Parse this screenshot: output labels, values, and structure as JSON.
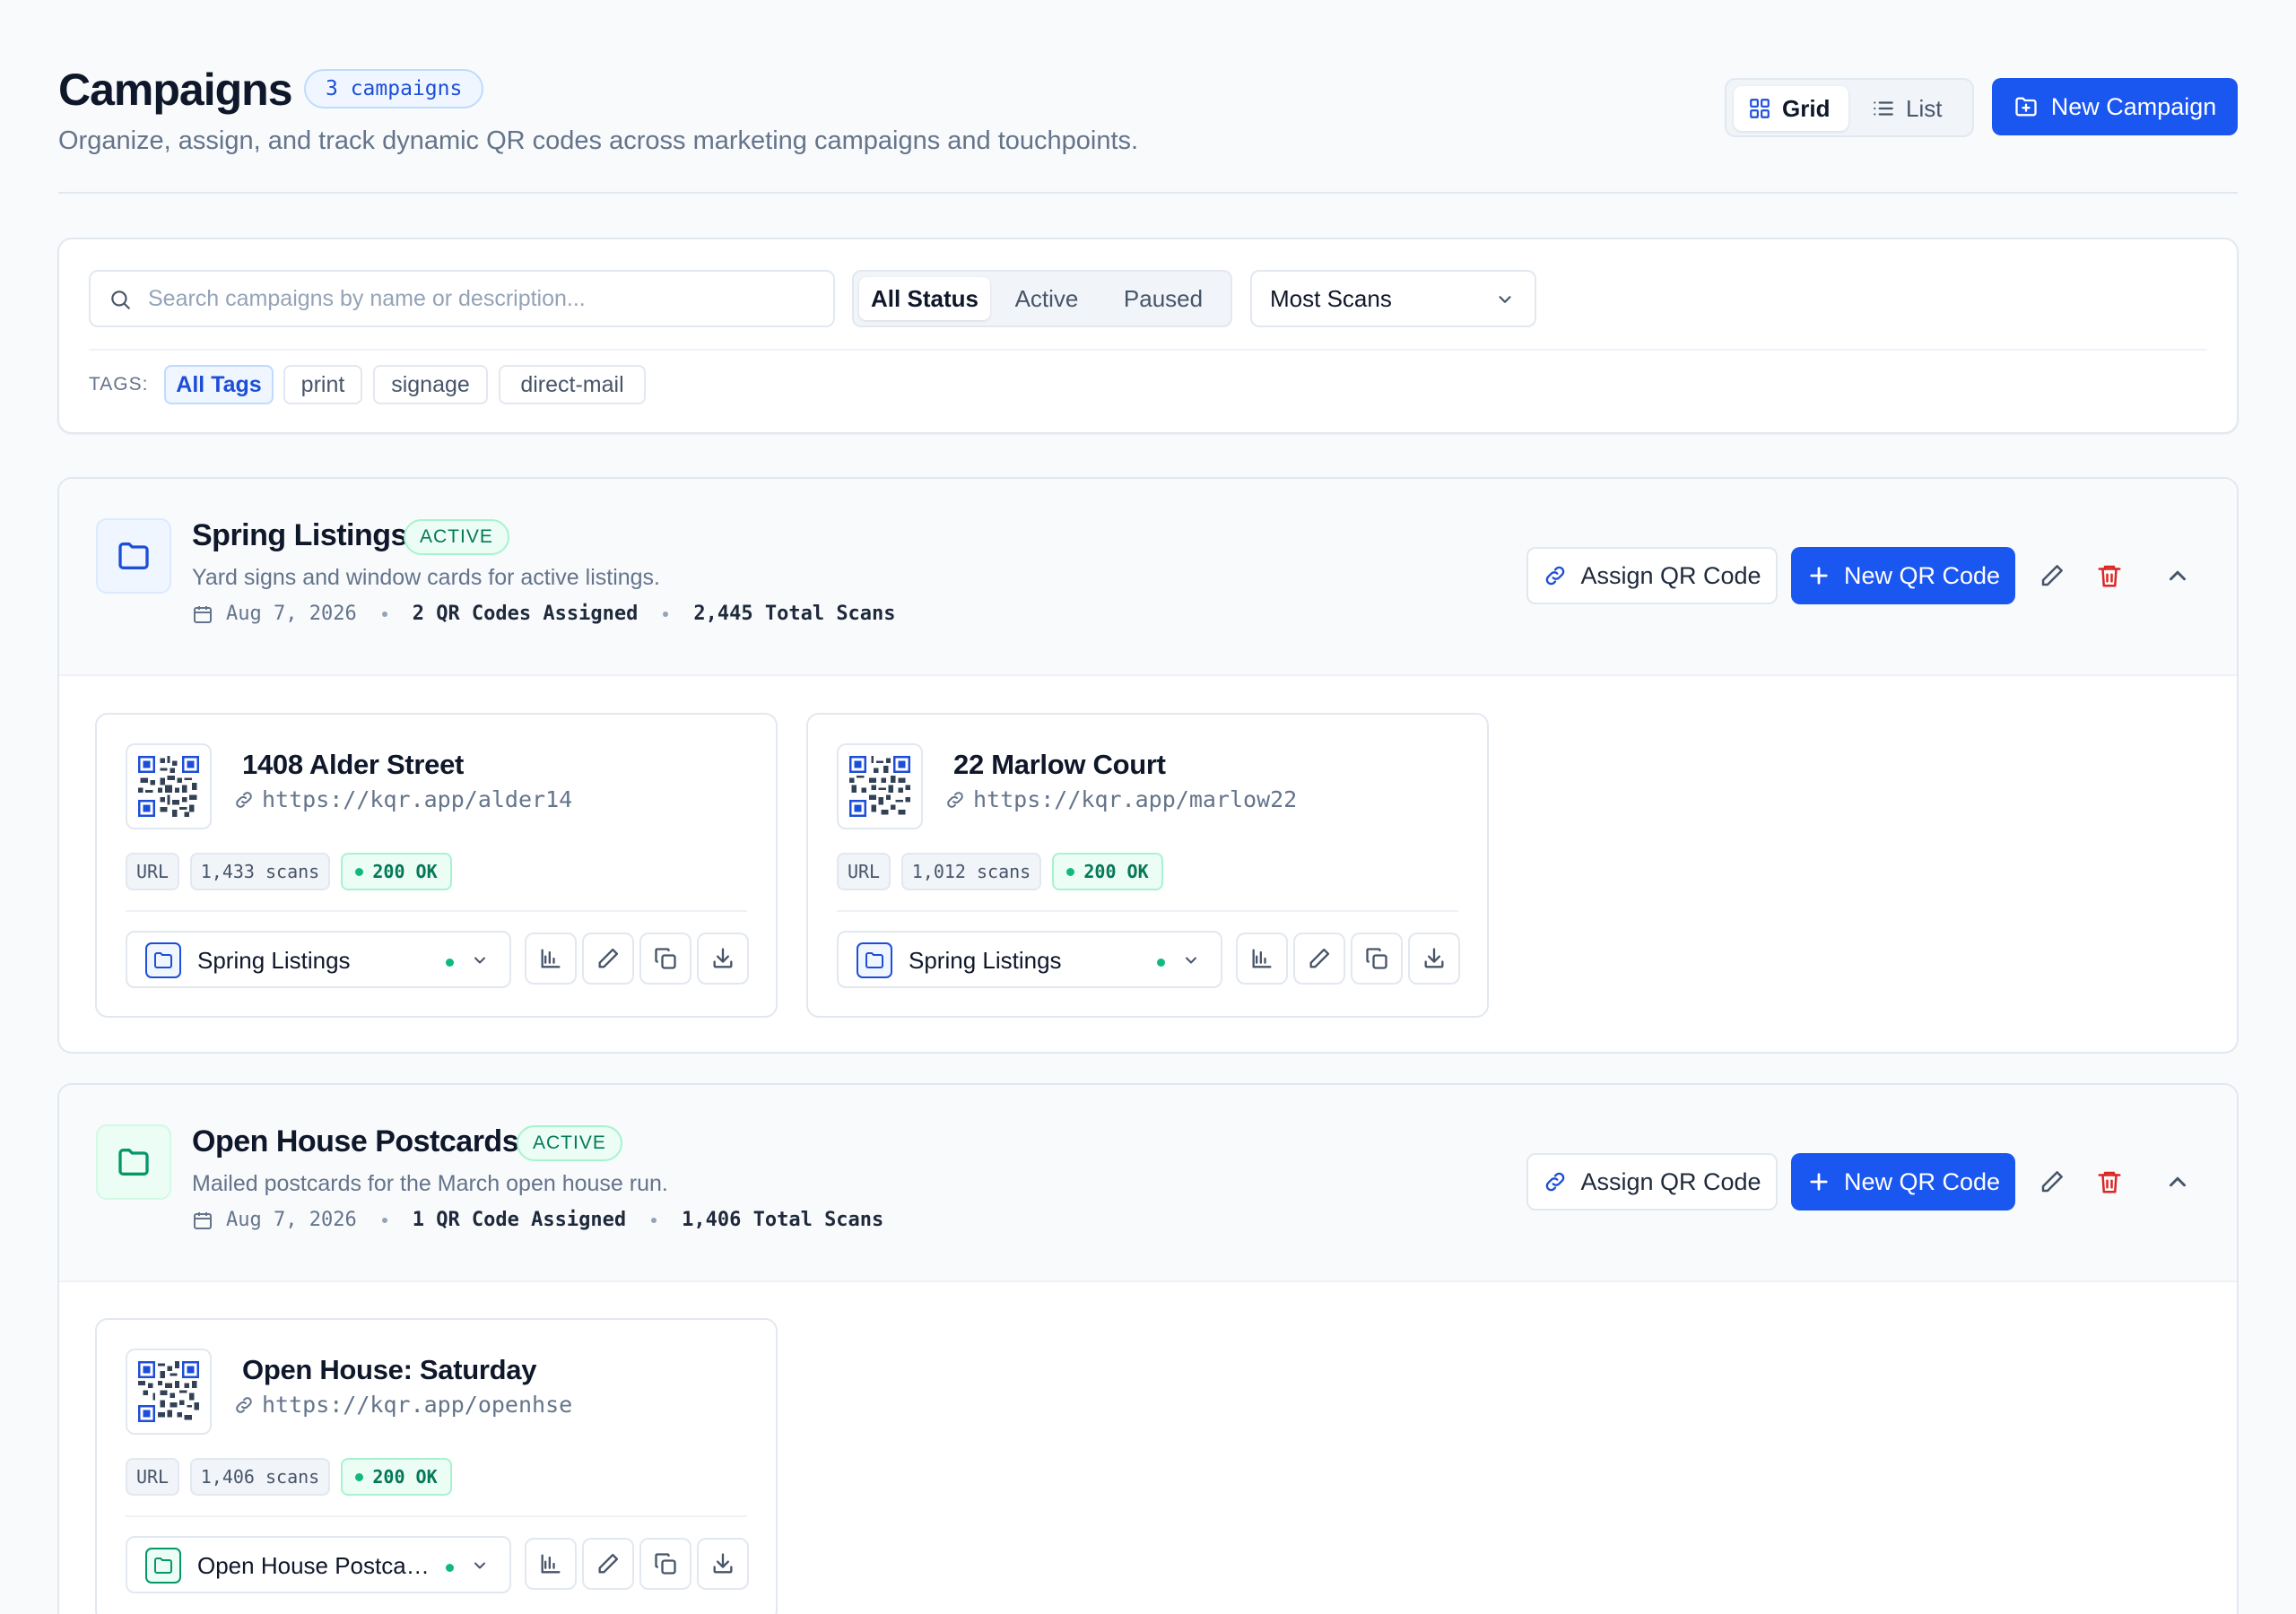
{
  "header": {
    "title": "Campaigns",
    "count_badge": "3 campaigns",
    "subtitle": "Organize, assign, and track dynamic QR codes across marketing campaigns and touchpoints.",
    "view_grid": "Grid",
    "view_list": "List",
    "view_active": "Grid",
    "new_campaign": "New Campaign"
  },
  "filters": {
    "search_placeholder": "Search campaigns by name or description...",
    "search_value": "",
    "status_options": [
      "All Status",
      "Active",
      "Paused"
    ],
    "status_selected": "All Status",
    "sort_selected": "Most Scans",
    "tags_label": "TAGS:",
    "tags": [
      "All Tags",
      "print",
      "signage",
      "direct-mail"
    ],
    "tag_selected": "All Tags"
  },
  "campaigns": [
    {
      "name": "Spring Listings",
      "status": "ACTIVE",
      "description": "Yard signs and window cards for active listings.",
      "date": "Aug 7, 2026",
      "assigned": "2 QR Codes Assigned",
      "total_scans": "2,445 Total Scans",
      "folder_color": "blue",
      "assign_label": "Assign QR Code",
      "new_qr_label": "New QR Code",
      "qr_codes": [
        {
          "name": "1408 Alder Street",
          "url": "https://kqr.app/alder14",
          "type": "URL",
          "scans": "1,433 scans",
          "http": "200 OK",
          "campaign": "Spring Listings"
        },
        {
          "name": "22 Marlow Court",
          "url": "https://kqr.app/marlow22",
          "type": "URL",
          "scans": "1,012 scans",
          "http": "200 OK",
          "campaign": "Spring Listings"
        }
      ]
    },
    {
      "name": "Open House Postcards",
      "status": "ACTIVE",
      "description": "Mailed postcards for the March open house run.",
      "date": "Aug 7, 2026",
      "assigned": "1 QR Code Assigned",
      "total_scans": "1,406 Total Scans",
      "folder_color": "green",
      "assign_label": "Assign QR Code",
      "new_qr_label": "New QR Code",
      "qr_codes": [
        {
          "name": "Open House: Saturday",
          "url": "https://kqr.app/openhse",
          "type": "URL",
          "scans": "1,406 scans",
          "http": "200 OK",
          "campaign": "Open House Postcards"
        }
      ]
    }
  ],
  "colors": {
    "primary": "#1a56f0",
    "success": "#10b981",
    "danger": "#dc2626",
    "folder_blue": "#1d4ed8",
    "folder_green": "#059669"
  },
  "icons": [
    "grid-icon",
    "list-icon",
    "folder-plus-icon",
    "search-icon",
    "chevron-down-icon",
    "folder-icon",
    "calendar-icon",
    "link-icon",
    "plus-icon",
    "pencil-icon",
    "trash-icon",
    "chevron-up-icon",
    "qr-code-icon",
    "bar-chart-icon",
    "copy-icon",
    "download-icon"
  ]
}
